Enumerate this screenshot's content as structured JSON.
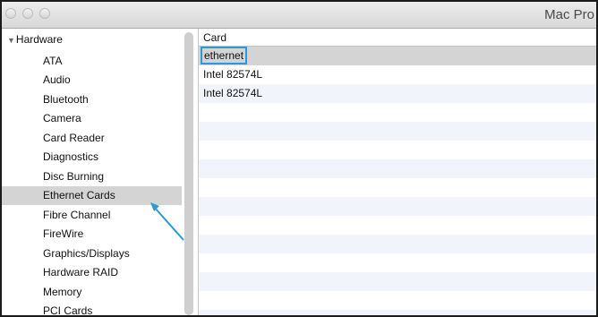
{
  "window": {
    "title": "Mac Pro"
  },
  "sidebar": {
    "group_label": "Hardware",
    "items": [
      {
        "label": "ATA"
      },
      {
        "label": "Audio"
      },
      {
        "label": "Bluetooth"
      },
      {
        "label": "Camera"
      },
      {
        "label": "Card Reader"
      },
      {
        "label": "Diagnostics"
      },
      {
        "label": "Disc Burning"
      },
      {
        "label": "Ethernet Cards"
      },
      {
        "label": "Fibre Channel"
      },
      {
        "label": "FireWire"
      },
      {
        "label": "Graphics/Displays"
      },
      {
        "label": "Hardware RAID"
      },
      {
        "label": "Memory"
      },
      {
        "label": "PCI Cards"
      }
    ],
    "selected_label": "Ethernet Cards"
  },
  "table": {
    "column_header": "Card",
    "rows": [
      "ethernet",
      "Intel 82574L",
      "Intel 82574L"
    ]
  },
  "colors": {
    "annotation": "#2b9ad6",
    "selection": "#d4d4d4"
  }
}
